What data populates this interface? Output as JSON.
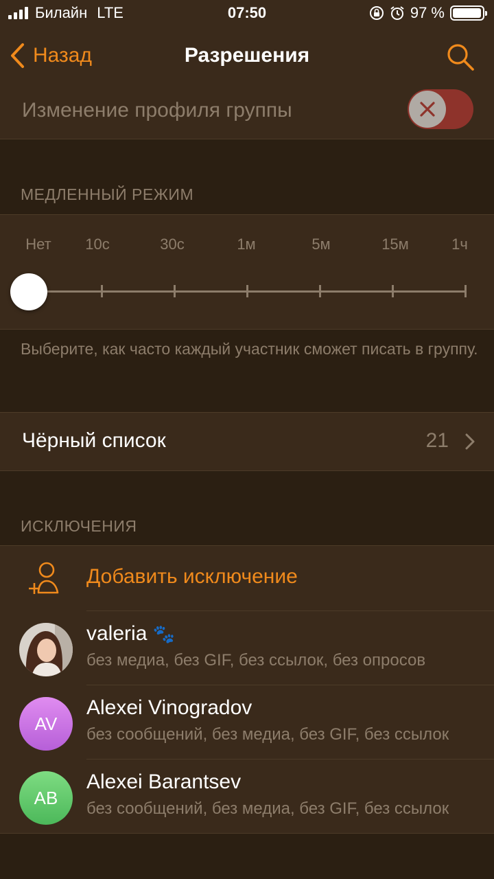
{
  "status": {
    "carrier": "Билайн",
    "network": "LTE",
    "time": "07:50",
    "battery": "97 %"
  },
  "nav": {
    "back_label": "Назад",
    "title": "Разрешения"
  },
  "profile_row": {
    "label": "Изменение профиля группы",
    "enabled": false
  },
  "slow_mode": {
    "header": "МЕДЛЕННЫЙ РЕЖИМ",
    "options": [
      "Нет",
      "10с",
      "30с",
      "1м",
      "5м",
      "15м",
      "1ч"
    ],
    "selected": "Нет",
    "footnote": "Выберите, как часто каждый участник сможет писать в группу."
  },
  "blacklist": {
    "label": "Чёрный список",
    "count": "21"
  },
  "exceptions": {
    "header": "ИСКЛЮЧЕНИЯ",
    "add_label": "Добавить исключение",
    "users": [
      {
        "name": "valeria",
        "subtitle": "без медиа, без GIF, без ссылок, без опросов",
        "initials": "",
        "avatar_color": "#6b5a4a"
      },
      {
        "name": "Alexei Vinogradov",
        "subtitle": "без сообщений, без медиа, без GIF, без ссылок",
        "initials": "AV",
        "avatar_color": "#c86fe0"
      },
      {
        "name": "Alexei Barantsev",
        "subtitle": "без сообщений, без медиа, без GIF, без ссылок",
        "initials": "AB",
        "avatar_color": "#5cc46a"
      }
    ]
  },
  "colors": {
    "accent": "#f08a1c",
    "background": "#2b1f12",
    "panel": "#3a2a1b",
    "muted_text": "#8d7d6b",
    "toggle_off": "#c63a37"
  }
}
